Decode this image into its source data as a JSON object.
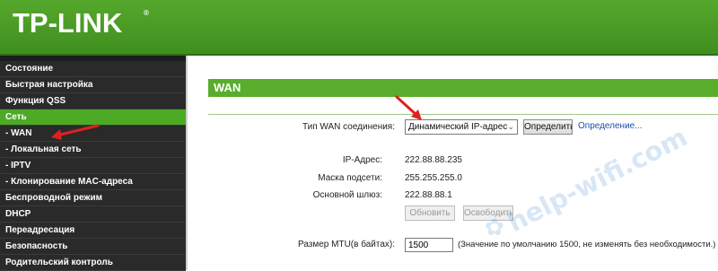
{
  "brand": {
    "logo_text": "TP-LINK",
    "trademark": "®"
  },
  "sidebar": {
    "items": [
      {
        "label": "Состояние"
      },
      {
        "label": "Быстрая настройка"
      },
      {
        "label": "Функция QSS"
      },
      {
        "label": "Сеть",
        "active": true
      },
      {
        "label": "- WAN",
        "selected": true
      },
      {
        "label": "- Локальная сеть"
      },
      {
        "label": "- IPTV"
      },
      {
        "label": "- Клонирование MAC-адреса"
      },
      {
        "label": "Беспроводной режим"
      },
      {
        "label": "DHCP"
      },
      {
        "label": "Переадресация"
      },
      {
        "label": "Безопасность"
      },
      {
        "label": "Родительский контроль"
      }
    ]
  },
  "main": {
    "section_title": "WAN",
    "wan_type": {
      "label": "Тип WAN соединения:",
      "selected": "Динамический IP-адрес",
      "detect_button": "Определить",
      "detect_link": "Определение..."
    },
    "ip": {
      "label": "IP-Адрес:",
      "value": "222.88.88.235"
    },
    "mask": {
      "label": "Маска подсети:",
      "value": "255.255.255.0"
    },
    "gateway": {
      "label": "Основной шлюз:",
      "value": "222.88.88.1"
    },
    "renew_button": "Обновить",
    "release_button": "Освободить",
    "mtu": {
      "label": "Размер MTU(в байтах):",
      "value": "1500",
      "note": "(Значение по умолчанию 1500, не изменять без необходимости.)"
    }
  },
  "watermark": {
    "text": "help-wifi.com"
  },
  "colors": {
    "brand_green": "#4caa24",
    "annotation_red": "#e02020",
    "link_blue": "#1b4fa8"
  }
}
